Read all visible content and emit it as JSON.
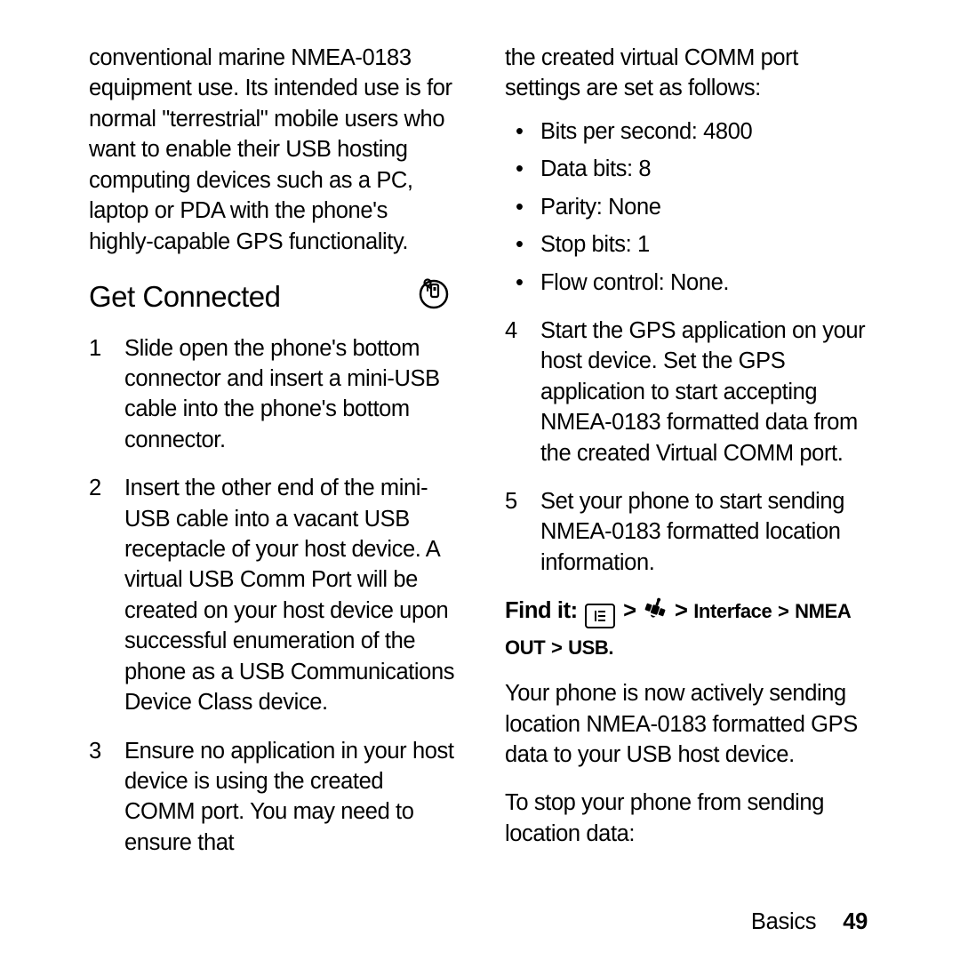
{
  "left": {
    "intro": "conventional marine NMEA-0183 equipment use.  Its intended use is for normal \"terrestrial\" mobile users who want to enable their USB hosting computing devices such as a PC, laptop or PDA with the phone's highly-capable GPS functionality.",
    "heading": "Get Connected",
    "steps": [
      {
        "n": "1",
        "t": "Slide open the phone's bottom connector and insert a mini-USB cable into the phone's bottom connector."
      },
      {
        "n": "2",
        "t": "Insert the other end of the mini-USB cable into a vacant USB receptacle of your host device. A virtual USB Comm Port will be created on your host device upon successful enumeration of the phone as a USB Communications Device Class device."
      },
      {
        "n": "3",
        "t": "Ensure no application in your host device is using the created COMM port.  You may need to ensure that"
      }
    ]
  },
  "right": {
    "continuation": "the created virtual COMM port settings are set as follows:",
    "bullets": [
      "Bits per second: 4800",
      "Data bits: 8",
      "Parity: None",
      "Stop bits: 1",
      "Flow control: None."
    ],
    "steps": [
      {
        "n": "4",
        "t": "Start the GPS application on your host device.  Set the GPS application to start accepting NMEA-0183 formatted data from the created Virtual COMM port."
      },
      {
        "n": "5",
        "t": "Set your phone to start sending NMEA-0183 formatted location information."
      }
    ],
    "findit": {
      "label": "Find it:",
      "sep": ">",
      "path_interface": "Interface",
      "path_nmea": "NMEA OUT",
      "path_usb": "USB"
    },
    "para1": "Your phone is now actively sending location NMEA-0183 formatted GPS data to your USB host device.",
    "para2": "To stop your phone from sending location data:"
  },
  "footer": {
    "section": "Basics",
    "page": "49"
  }
}
